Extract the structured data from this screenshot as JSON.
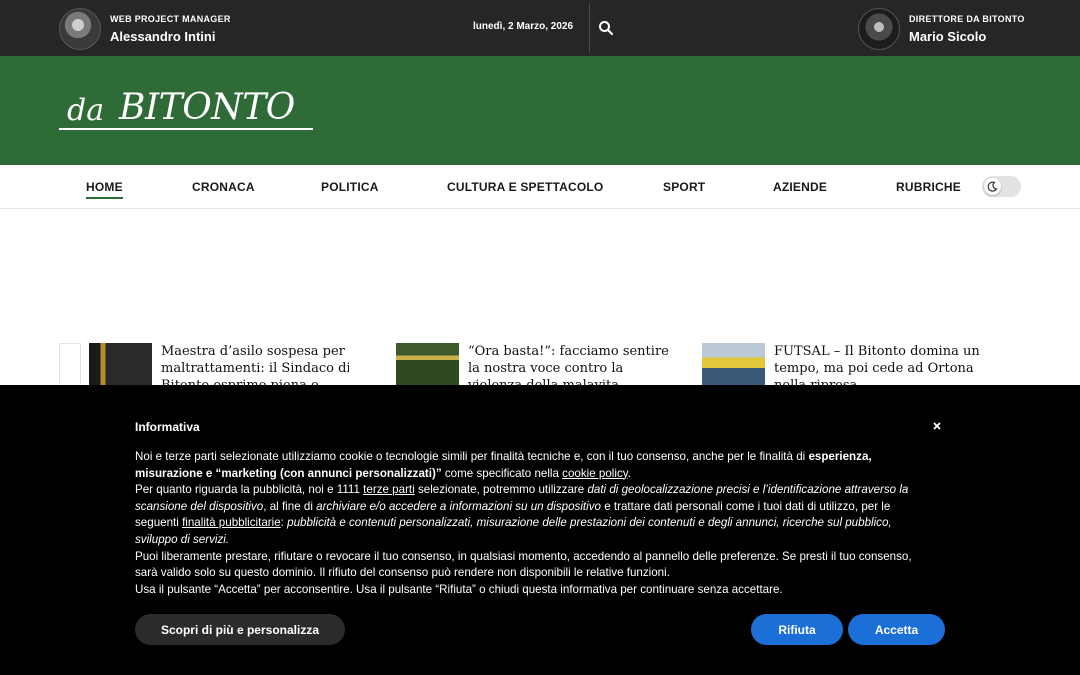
{
  "topbar": {
    "left_person": {
      "role": "WEB PROJECT MANAGER",
      "name": "Alessandro Intini"
    },
    "date": "lunedì, 2 Marzo, 2026",
    "right_person": {
      "role": "DIRETTORE DA BITONTO",
      "name": "Mario Sicolo"
    }
  },
  "logo": {
    "prefix": "da",
    "name": "BITONTO"
  },
  "nav": {
    "items": [
      "HOME",
      "CRONACA",
      "POLITICA",
      "CULTURA E SPETTACOLO",
      "SPORT",
      "AZIENDE",
      "RUBRICHE"
    ],
    "active": "HOME"
  },
  "articles": [
    {
      "title": "Maestra d’asilo sospesa per maltrattamenti: il Sindaco di Bitonto esprime piena e"
    },
    {
      "title": "“Ora basta!”: facciamo sentire la nostra voce contro la violenza della malavita"
    },
    {
      "title": "FUTSAL – Il Bitonto domina un tempo, ma poi cede ad Ortona nella ripresa"
    }
  ],
  "cookie": {
    "title": "Informativa",
    "p1_a": "Noi e terze parti selezionate utilizziamo cookie o tecnologie simili per finalità tecniche e, con il tuo consenso, anche per le finalità di ",
    "p1_b": "esperienza, misurazione e “marketing (con annunci personalizzati)”",
    "p1_c": " come specificato nella ",
    "p1_link": "cookie policy",
    "p1_d": ".",
    "p2_a": "Per quanto riguarda la pubblicità, noi e 1111 ",
    "p2_link1": "terze parti",
    "p2_b": " selezionate, potremmo utilizzare ",
    "p2_c": "dati di geolocalizzazione precisi e l’identificazione attraverso la scansione del dispositivo",
    "p2_d": ", al fine di ",
    "p2_e": "archiviare e/o accedere a informazioni su un dispositivo",
    "p2_f": " e trattare dati personali come i tuoi dati di utilizzo, per le seguenti ",
    "p2_link2": "finalità pubblicitarie",
    "p2_g": ": ",
    "p2_h": "pubblicità e contenuti personalizzati, misurazione delle prestazioni dei contenuti e degli annunci, ricerche sul pubblico, sviluppo di servizi.",
    "p3": "Puoi liberamente prestare, rifiutare o revocare il tuo consenso, in qualsiasi momento, accedendo al pannello delle preferenze. Se presti il tuo consenso, sarà valido solo su questo dominio. Il rifiuto del consenso può rendere non disponibili le relative funzioni.",
    "p4": "Usa il pulsante “Accetta” per acconsentire. Usa il pulsante “Rifiuta” o chiudi questa informativa per continuare senza accettare.",
    "btn_more": "Scopri di più e personalizza",
    "btn_reject": "Rifiuta",
    "btn_accept": "Accetta"
  },
  "colors": {
    "header_green": "#2e6b36",
    "topbar": "#262626",
    "button_blue": "#1b6fd6",
    "banner": "#000000"
  },
  "icons": {
    "search": "search-icon",
    "close": "close-icon",
    "dark_mode": "moon-icon"
  }
}
